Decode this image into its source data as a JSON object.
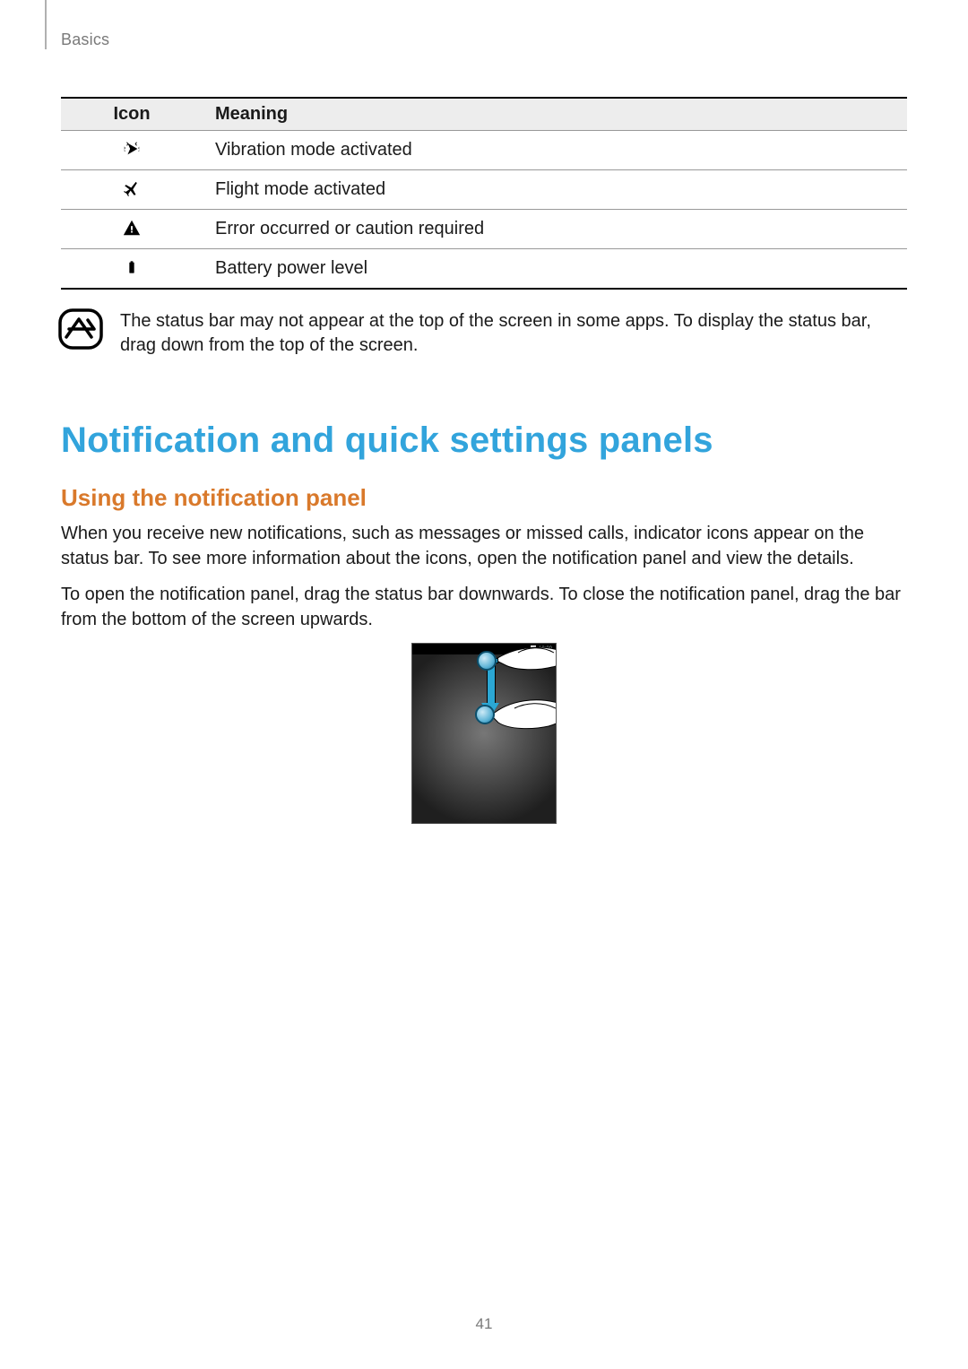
{
  "header": {
    "section_label": "Basics"
  },
  "table": {
    "columns": {
      "icon": "Icon",
      "meaning": "Meaning"
    },
    "rows": [
      {
        "icon_name": "vibration-icon",
        "meaning": "Vibration mode activated"
      },
      {
        "icon_name": "airplane-icon",
        "meaning": "Flight mode activated"
      },
      {
        "icon_name": "warning-icon",
        "meaning": "Error occurred or caution required"
      },
      {
        "icon_name": "battery-icon",
        "meaning": "Battery power level"
      }
    ]
  },
  "note": {
    "text": "The status bar may not appear at the top of the screen in some apps. To display the status bar, drag down from the top of the screen."
  },
  "headings": {
    "h1": "Notification and quick settings panels",
    "h2": "Using the notification panel"
  },
  "paragraphs": {
    "p1": "When you receive new notifications, such as messages or missed calls, indicator icons appear on the status bar. To see more information about the icons, open the notification panel and view the details.",
    "p2": "To open the notification panel, drag the status bar downwards. To close the notification panel, drag the bar from the bottom of the screen upwards."
  },
  "illustration": {
    "status_time": "10:00"
  },
  "page_number": "41"
}
